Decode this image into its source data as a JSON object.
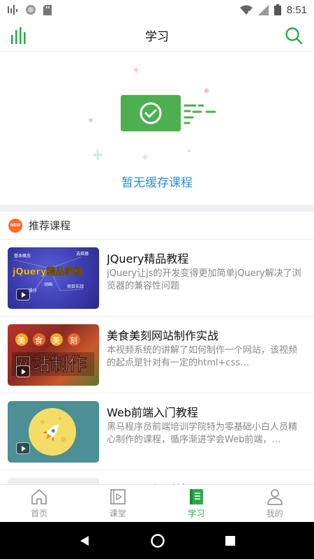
{
  "status_bar": {
    "time": "8:51"
  },
  "header": {
    "title": "学习"
  },
  "empty_state": {
    "message": "暂无缓存课程"
  },
  "recommend": {
    "badge": "NEW",
    "title": "推荐课程",
    "courses": [
      {
        "title": "JQuery精品教程",
        "desc": "jQuery让js的开发变得更加简单jQuery解决了浏览器的兼容性问题",
        "thumb_text": "jQuery精品教程",
        "thumb_small": [
          "基本概念",
          "选择器",
          "动画",
          "操作",
          "项目实战"
        ]
      },
      {
        "title": "美食美刻网站制作实战",
        "desc": "本视频系统的讲解了如何制作一个网站，该视频的起点是针对有一定的html+css…",
        "thumb_top": [
          "美",
          "食",
          "美",
          "刻"
        ],
        "thumb_text": "网站制作"
      },
      {
        "title": "Web前端入门教程",
        "desc": "黑马程序员前端培训学院特为零基础小白人员精心制作的课程，循序渐进学会Web前端，…"
      },
      {
        "title": "Ajax从入门到精通"
      }
    ]
  },
  "tabs": [
    {
      "label": "首页",
      "icon": "home-icon"
    },
    {
      "label": "课堂",
      "icon": "video-icon"
    },
    {
      "label": "学习",
      "icon": "book-icon",
      "active": true
    },
    {
      "label": "我的",
      "icon": "user-icon"
    }
  ],
  "colors": {
    "accent": "#2eaa4b",
    "link": "#2d8fd6"
  }
}
